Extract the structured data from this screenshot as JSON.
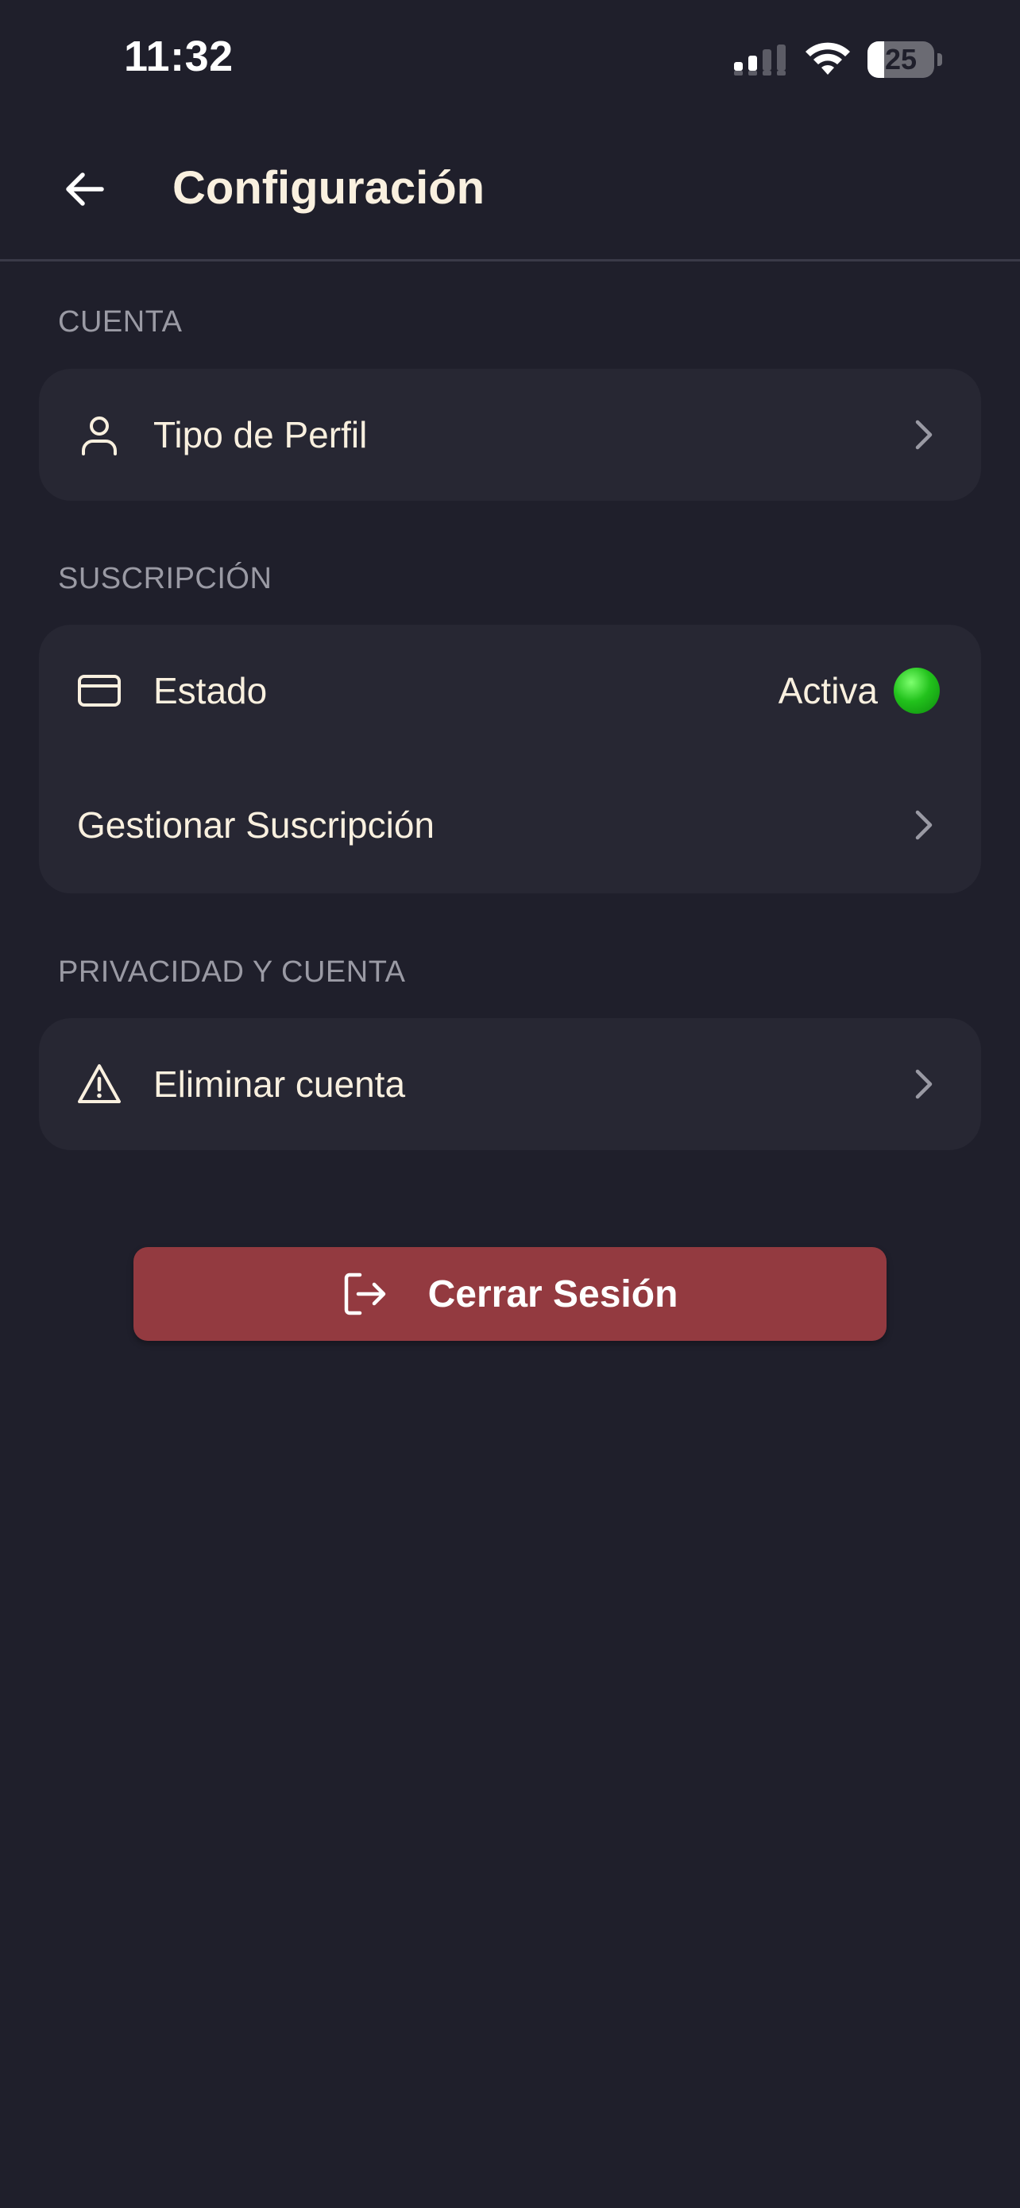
{
  "status_bar": {
    "time": "11:32",
    "battery_level": "25",
    "battery_fraction": 0.25
  },
  "header": {
    "title": "Configuración",
    "back_icon": "arrow-left-icon"
  },
  "sections": {
    "account": {
      "label": "CUENTA",
      "items": [
        {
          "label": "Tipo de Perfil",
          "icon": "user-icon"
        }
      ]
    },
    "subscription": {
      "label": "SUSCRIPCIÓN",
      "items": [
        {
          "label": "Estado",
          "icon": "credit-card-icon",
          "value": "Activa",
          "status_color": "#22c21c"
        },
        {
          "label": "Gestionar Suscripción"
        }
      ]
    },
    "privacy": {
      "label": "PRIVACIDAD Y CUENTA",
      "items": [
        {
          "label": "Eliminar cuenta",
          "icon": "warning-triangle-icon"
        }
      ]
    }
  },
  "logout": {
    "label": "Cerrar Sesión",
    "icon": "logout-icon",
    "color": "#933a40"
  },
  "colors": {
    "background": "#1f1f2b",
    "card": "#272733",
    "text": "#f9f0df",
    "muted": "#9a9aa4"
  }
}
